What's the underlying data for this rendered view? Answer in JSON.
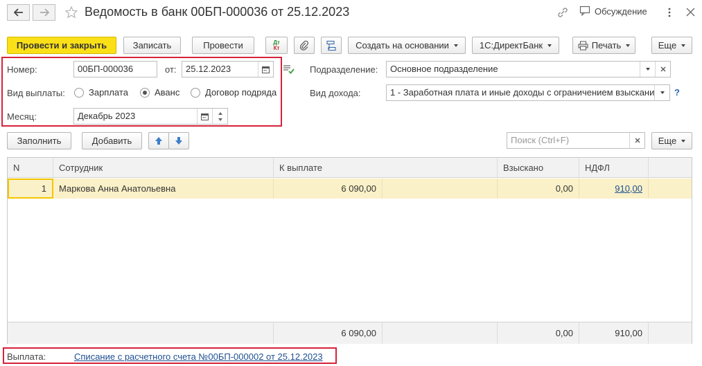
{
  "window": {
    "title": "Ведомость в банк 00БП-000036 от 25.12.2023",
    "discussion_label": "Обсуждение"
  },
  "toolbar": {
    "post_close": "Провести и закрыть",
    "save": "Записать",
    "post": "Провести",
    "dt_kt_top": "Дт",
    "dt_kt_bottom": "Кт",
    "create_based": "Создать на основании",
    "direct_bank": "1С:ДиректБанк",
    "print": "Печать",
    "more": "Еще"
  },
  "form": {
    "number_label": "Номер:",
    "number_value": "00БП-000036",
    "date_label": "от:",
    "date_value": "25.12.2023",
    "subdivision_label": "Подразделение:",
    "subdivision_value": "Основное подразделение",
    "payment_type_label": "Вид выплаты:",
    "payment_options": [
      "Зарплата",
      "Аванс",
      "Договор подряда"
    ],
    "payment_selected": "Аванс",
    "income_type_label": "Вид дохода:",
    "income_type_value": "1 - Заработная плата и иные доходы с ограничением взыскания",
    "help": "?",
    "month_label": "Месяц:",
    "month_value": "Декабрь 2023"
  },
  "table_toolbar": {
    "fill": "Заполнить",
    "add": "Добавить",
    "search_placeholder": "Поиск (Ctrl+F)",
    "more": "Еще"
  },
  "table": {
    "columns": [
      "N",
      "Сотрудник",
      "К выплате",
      "Взыскано",
      "НДФЛ"
    ],
    "rows": [
      {
        "n": "1",
        "employee": "Маркова Анна Анатольевна",
        "to_pay": "6 090,00",
        "recovered": "0,00",
        "ndfl": "910,00"
      }
    ],
    "totals": {
      "to_pay": "6 090,00",
      "recovered": "0,00",
      "ndfl": "910,00"
    }
  },
  "footer": {
    "payment_label": "Выплата:",
    "payment_link": "Списание с расчетного счета №00БП-000002 от 25.12.2023"
  },
  "colors": {
    "primary": "#fbe018",
    "highlight_row": "#fbf1c8",
    "red_frame": "#d6223a",
    "link": "#1d4f91"
  }
}
